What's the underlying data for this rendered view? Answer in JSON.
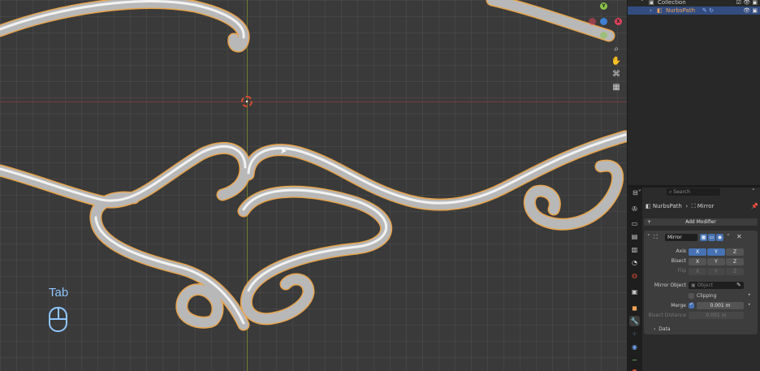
{
  "viewport": {
    "overlay_key": "Tab",
    "colors": {
      "x_axis": "#7a3b3e",
      "y_axis": "#6f7a2e",
      "curve": "#c8c8c8",
      "outline": "#e9a34a"
    },
    "gizmo": {
      "y": "Y",
      "x": "X"
    }
  },
  "outliner": {
    "collection_label": "Collection",
    "object_label": "NurbsPath"
  },
  "properties": {
    "search_placeholder": "Search",
    "breadcrumb_object": "NurbsPath",
    "breadcrumb_modifier": "Mirror",
    "add_modifier_label": "Add Modifier",
    "modifier": {
      "name": "Mirror",
      "axis_label": "Axis",
      "bisect_label": "Bisect",
      "flip_label": "Flip",
      "axis_values": [
        "X",
        "Y",
        "Z"
      ],
      "axis_active": [
        true,
        true,
        false
      ],
      "mirror_object_label": "Mirror Object",
      "mirror_object_placeholder": "Object",
      "clipping_label": "Clipping",
      "merge_label": "Merge",
      "merge_value": "0.001 m",
      "bisect_distance_label": "Bisect Distance",
      "bisect_distance_value": "0.001 m",
      "data_section_label": "Data"
    }
  }
}
